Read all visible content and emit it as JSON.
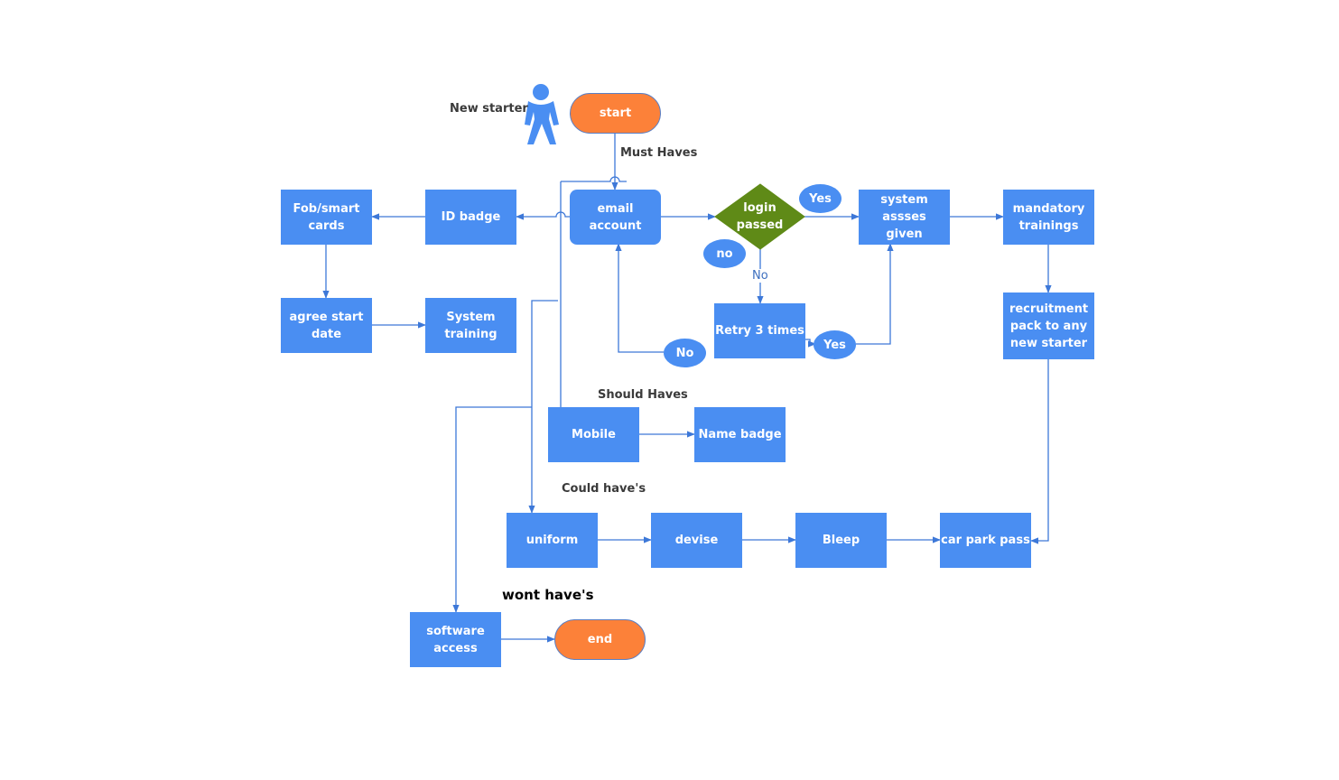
{
  "diagram": {
    "actor": {
      "label": "New starter",
      "icon": "person-icon"
    },
    "sections": {
      "must": "Must Haves",
      "should": "Should Haves",
      "could": "Could have's",
      "wont": "wont have's"
    },
    "nodes": {
      "start": "start",
      "end": "end",
      "email_account": "email\naccount",
      "id_badge": "ID badge",
      "fob_cards": "Fob/smart\ncards",
      "agree_start_date": "agree start\ndate",
      "system_training": "System\ntraining",
      "login_passed": "login\npassed",
      "retry": "Retry 3 times",
      "system_access": "system assses\ngiven",
      "mandatory_trainings": "mandatory\ntrainings",
      "recruitment_pack": "recruitment\npack to any\nnew starter",
      "mobile": "Mobile",
      "name_badge": "Name badge",
      "uniform": "uniform",
      "devise": "devise",
      "bleep": "Bleep",
      "car_park_pass": "car park pass",
      "software_access": "software\naccess"
    },
    "ovals": {
      "yes_top": "Yes",
      "no_left": "no",
      "yes_retry": "Yes",
      "no_retry": "No"
    },
    "edge_labels": {
      "no_down": "No"
    },
    "colors": {
      "box": "#4a8ef2",
      "terminal": "#fc8139",
      "decision": "#5f8a17",
      "connector": "#3d78d8"
    }
  }
}
